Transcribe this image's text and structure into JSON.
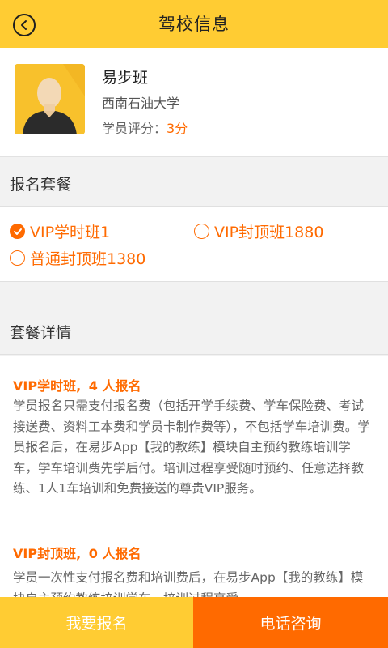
{
  "header": {
    "title": "驾校信息",
    "back_icon": "back-arrow-circle-icon"
  },
  "profile": {
    "avatar_icon": "person-silhouette-icon",
    "name": "易步班",
    "university": "西南石油大学",
    "rating_label": "学员评分：",
    "rating_value": "3分"
  },
  "packages_section": {
    "title": "报名套餐",
    "options": [
      {
        "label": "VIP学时班1",
        "selected": true
      },
      {
        "label": "VIP封顶班1880",
        "selected": false
      },
      {
        "label": "普通封顶班1380",
        "selected": false
      }
    ]
  },
  "details_section": {
    "title": "套餐详情",
    "items": [
      {
        "name": "VIP学时班,",
        "count": "4",
        "count_suffix": "人报名",
        "body": "学员报名只需支付报名费（包括开学手续费、学车保险费、考试接送费、资料工本费和学员卡制作费等），不包括学车培训费。学员报名后，在易步App【我的教练】模块自主预约教练培训学车，学车培训费先学后付。培训过程享受随时预约、任意选择教练、1人1车培训和免费接送的尊贵VIP服务。"
      },
      {
        "name": "VIP封顶班,",
        "count": "0",
        "count_suffix": "人报名",
        "body": "学员一次性支付报名费和培训费后，在易步App【我的教练】模块自主预约教练培训学车，培训过程享受"
      }
    ]
  },
  "footer": {
    "enroll_label": "我要报名",
    "phone_label": "电话咨询"
  },
  "colors": {
    "accent_yellow": "#ffcc33",
    "accent_orange": "#ff6a00"
  }
}
